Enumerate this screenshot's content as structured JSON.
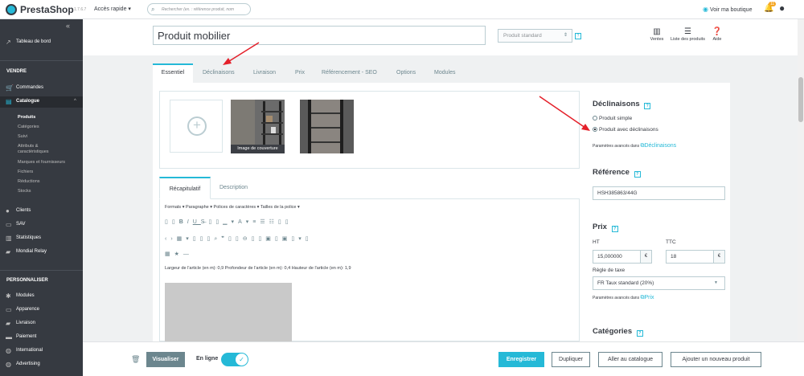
{
  "topbar": {
    "brand": "PrestaShop",
    "version": "1.7.6.7",
    "quick_access": "Accès rapide ▾",
    "search_placeholder": "Rechercher (ex. : référence produit, nom",
    "view_shop": "Voir ma boutique",
    "notif_count": "11"
  },
  "sidebar": {
    "collapse": "«",
    "dashboard": "Tableau de bord",
    "sec_sell": "VENDRE",
    "orders": "Commandes",
    "catalog": "Catalogue",
    "catalog_sub": [
      "Produits",
      "Catégories",
      "Suivi",
      "Attributs &",
      "caractéristiques",
      "Marques et fournisseurs",
      "Fichiers",
      "Réductions",
      "Stocks"
    ],
    "customers": "Clients",
    "sav": "SAV",
    "stats": "Statistiques",
    "mondial": "Mondial Relay",
    "sec_custom": "PERSONNALISER",
    "modules": "Modules",
    "appearance": "Apparence",
    "shipping": "Livraison",
    "payment": "Paiement",
    "international": "International",
    "advertising": "Advertising"
  },
  "header": {
    "product_name": "Produit mobilier",
    "product_type": "Produit standard",
    "sales": "Ventes",
    "product_list": "Liste des produits",
    "help": "Aide"
  },
  "tabs": [
    "Essentiel",
    "Déclinaisons",
    "Livraison",
    "Prix",
    "Référencement - SEO",
    "Options",
    "Modules"
  ],
  "images": {
    "cover_label": "Image de couverture"
  },
  "editor": {
    "tabs": [
      "Récapitulatif",
      "Description"
    ],
    "menus": "Formats ▾    Paragraphe ▾    Polices de caractères ▾    Tailles de la police ▾",
    "content": "Largeur de l'article (en m): 0,9 Profondeur de l'article (en m): 0,4 Hauteur de l'article (en m): 1,9"
  },
  "right": {
    "declinaisons_title": "Déclinaisons",
    "opt_simple": "Produit simple",
    "opt_variants": "Produit avec déclinaisons",
    "advanced": "Paramètres avancés dans",
    "declinaisons_link": "Déclinaisons",
    "reference_title": "Référence",
    "reference_value": "HSH385863/44G",
    "price_title": "Prix",
    "ht": "HT",
    "ttc": "TTC",
    "ht_value": "15,000000",
    "ttc_value": "18",
    "currency": "€",
    "tax_label": "Règle de taxe",
    "tax_value": "FR Taux standard (20%)",
    "price_link": "Prix",
    "categories_title": "Catégories"
  },
  "footer": {
    "preview": "Visualiser",
    "online": "En ligne",
    "save": "Enregistrer",
    "duplicate": "Dupliquer",
    "to_catalog": "Aller au catalogue",
    "add_new": "Ajouter un nouveau produit"
  },
  "colors": {
    "accent": "#25b9d7",
    "sidebar": "#363a41",
    "arrow": "#e4202a"
  }
}
